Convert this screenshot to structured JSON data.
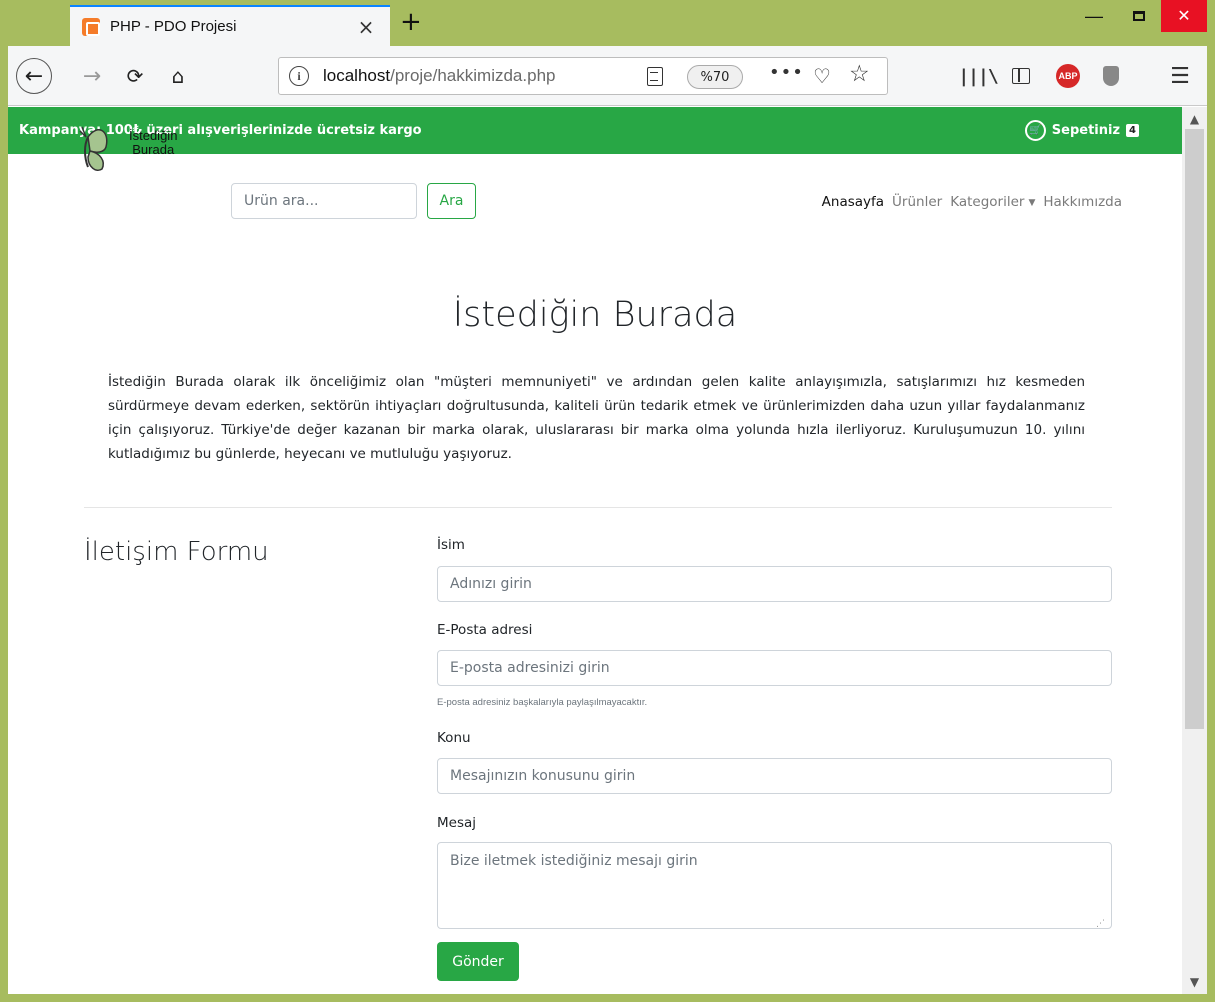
{
  "browser": {
    "tab_title": "PHP - PDO Projesi",
    "tab_close": "×",
    "new_tab": "+",
    "url_host": "localhost",
    "url_path": "/proje/hakkimizda.php",
    "zoom": "%70",
    "url_more": "•••",
    "icons": [
      "back-arrow-icon",
      "forward-arrow-icon",
      "reload-icon",
      "home-icon",
      "info-icon",
      "reader-view-icon",
      "pocket-icon",
      "bookmark-star-icon",
      "library-icon",
      "sidebar-icon",
      "adblock-icon",
      "shield-icon",
      "hamburger-menu-icon"
    ]
  },
  "promo": {
    "text": "Kampanya: 100₺ üzeri alışverişlerinizde ücretsiz kargo",
    "cart_label": "Sepetiniz",
    "cart_count": "4"
  },
  "logo": {
    "line1": "İstediğin",
    "line2": "Burada"
  },
  "search": {
    "placeholder": "Ürün ara...",
    "button": "Ara"
  },
  "nav": [
    {
      "label": "Anasayfa",
      "active": true
    },
    {
      "label": "Ürünler",
      "active": false
    },
    {
      "label": "Kategoriler",
      "active": false
    },
    {
      "label": "Hakkımızda",
      "active": false
    }
  ],
  "about": {
    "title": "İstediğin Burada",
    "text": "İstediğin Burada olarak ilk önceliğimiz olan \"müşteri memnuniyeti\" ve ardından gelen kalite anlayışımızla, satışlarımızı hız kesmeden sürdürmeye devam ederken, sektörün ihtiyaçları doğrultusunda, kaliteli ürün tedarik etmek ve ürünlerimizden daha uzun yıllar faydalanmanız için çalışıyoruz. Türkiye'de değer kazanan bir marka olarak, uluslararası bir marka olma yolunda hızla ilerliyoruz. Kuruluşumuzun 10. yılını kutladığımız bu günlerde, heyecanı ve mutluluğu yaşıyoruz."
  },
  "contact": {
    "title": "İletişim Formu",
    "name_label": "İsim",
    "name_placeholder": "Adınızı girin",
    "email_label": "E-Posta adresi",
    "email_placeholder": "E-posta adresinizi girin",
    "email_help": "E-posta adresiniz başkalarıyla paylaşılmayacaktır.",
    "subject_label": "Konu",
    "subject_placeholder": "Mesajınızın konusunu girin",
    "message_label": "Mesaj",
    "message_placeholder": "Bize iletmek istediğiniz mesajı girin",
    "submit": "Gönder"
  },
  "colors": {
    "brand_green": "#28a745",
    "window_frame": "#a7bc5f",
    "close_red": "#e81123"
  }
}
